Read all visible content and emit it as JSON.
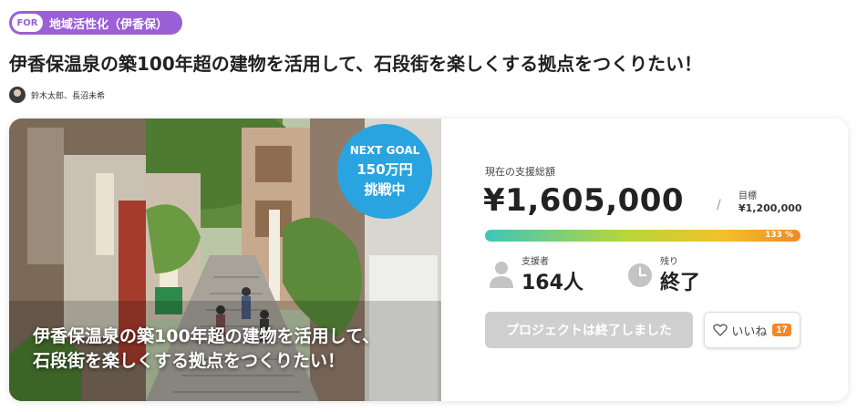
{
  "tag": {
    "for_label": "FOR",
    "text": "地域活性化（伊香保）"
  },
  "title": "伊香保温泉の築100年超の建物を活用して、石段街を楽しくする拠点をつくりたい！",
  "authors": "鈴木太郎、長沼未希",
  "hero": {
    "caption_line1": "伊香保温泉の築100年超の建物を活用して、",
    "caption_line2": "石段街を楽しくする拠点をつくりたい！"
  },
  "goal_badge": {
    "line1": "NEXT GOAL",
    "line2": "150万円",
    "line3": "挑戦中"
  },
  "funding": {
    "total_label": "現在の支援総額",
    "total_amount": "¥1,605,000",
    "slash": "/",
    "target_label": "目標",
    "target_value": "¥1,200,000",
    "progress_text": "133 %",
    "progress_percent": 133
  },
  "stats": {
    "supporters_label": "支援者",
    "supporters_value": "164人",
    "remaining_label": "残り",
    "remaining_value": "終了"
  },
  "actions": {
    "ended_button_label": "プロジェクトは終了しました",
    "like_label": "いいね",
    "like_count": "17"
  },
  "colors": {
    "tag_purple": "#9b5fd6",
    "badge_blue": "#29a4e0",
    "like_count_orange": "#f0872a"
  }
}
